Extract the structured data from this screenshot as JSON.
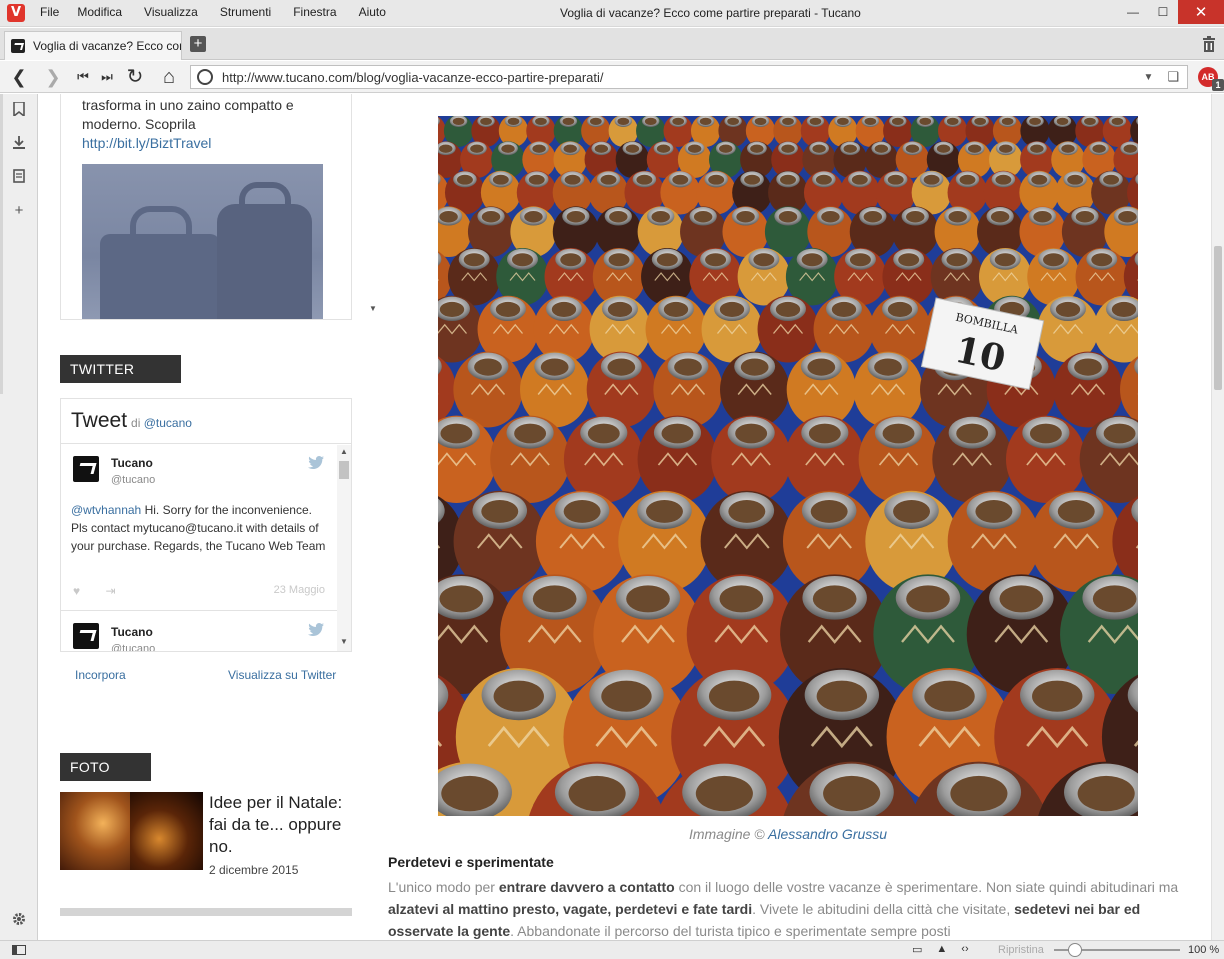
{
  "window": {
    "title": "Voglia di vacanze? Ecco come partire preparati - Tucano",
    "menu": [
      "File",
      "Modifica",
      "Visualizza",
      "Strumenti",
      "Finestra",
      "Aiuto"
    ],
    "controls": {
      "minimize": "—",
      "maximize": "☐",
      "close": "✕"
    }
  },
  "tabs": [
    {
      "label": "Voglia di vacanze? Ecco com"
    }
  ],
  "new_tab_label": "+",
  "nav": {
    "back": "❮",
    "forward": "❯",
    "rewind": "⏮",
    "fastforward": "⏭",
    "reload": "↻",
    "home": "⌂"
  },
  "address": {
    "url": "http://www.tucano.com/blog/voglia-vacanze-ecco-partire-preparati/",
    "dropdown": "▼",
    "bookmark": "❑"
  },
  "extension": {
    "label": "AB",
    "badge": "1"
  },
  "sidepanel_icons": [
    "bookmark-icon",
    "download-icon",
    "notes-icon",
    "add-panel-icon",
    "settings-icon"
  ],
  "sidebar": {
    "promo": {
      "text": "trasforma in uno zaino compatto e moderno. Scoprila",
      "link": "http://bit.ly/BiztTravel"
    },
    "twitter": {
      "section_label": "TWITTER",
      "heading": "Tweet",
      "heading_by": "di",
      "heading_handle": "@tucano",
      "tweets": [
        {
          "name": "Tucano",
          "handle": "@tucano",
          "mention": "@wtvhannah",
          "body": " Hi. Sorry for the inconvenience. Pls contact mytucano@tucano.it with details of your purchase. Regards, the Tucano Web Team",
          "date": "23 Maggio"
        },
        {
          "name": "Tucano",
          "handle": "@tucano"
        }
      ],
      "embed_link": "Incorpora",
      "view_link": "Visualizza su Twitter"
    },
    "foto": {
      "section_label": "FOTO",
      "title": "Idee per il Natale: fai da te... oppure no.",
      "date": "2 dicembre 2015"
    }
  },
  "article": {
    "caption_prefix": "Immagine ©",
    "caption_author": "Alessandro Grussu",
    "image_sign": {
      "top": "BOMBILLA",
      "number": "10"
    },
    "heading": "Perdetevi e sperimentate",
    "para_segments": [
      {
        "t": "L'unico modo per ",
        "b": false
      },
      {
        "t": "entrare davvero a contatto",
        "b": true
      },
      {
        "t": " con il luogo delle vostre vacanze è sperimentare. Non siate quindi abitudinari ma ",
        "b": false
      },
      {
        "t": "alzatevi al mattino presto, vagate, perdetevi e fate tardi",
        "b": true
      },
      {
        "t": ". Vivete le abitudini della città che visitate, ",
        "b": false
      },
      {
        "t": "sedetevi nei bar ed osservate la gente",
        "b": true
      },
      {
        "t": ". Abbandonate il percorso del turista tipico e sperimentate sempre posti",
        "b": false
      }
    ]
  },
  "statusbar": {
    "reset_label": "Ripristina",
    "zoom": "100 %",
    "zoom_level": 1.0
  },
  "colors": {
    "accent": "#e0352c",
    "link": "#3a6fa0",
    "label_bg": "#333333"
  }
}
